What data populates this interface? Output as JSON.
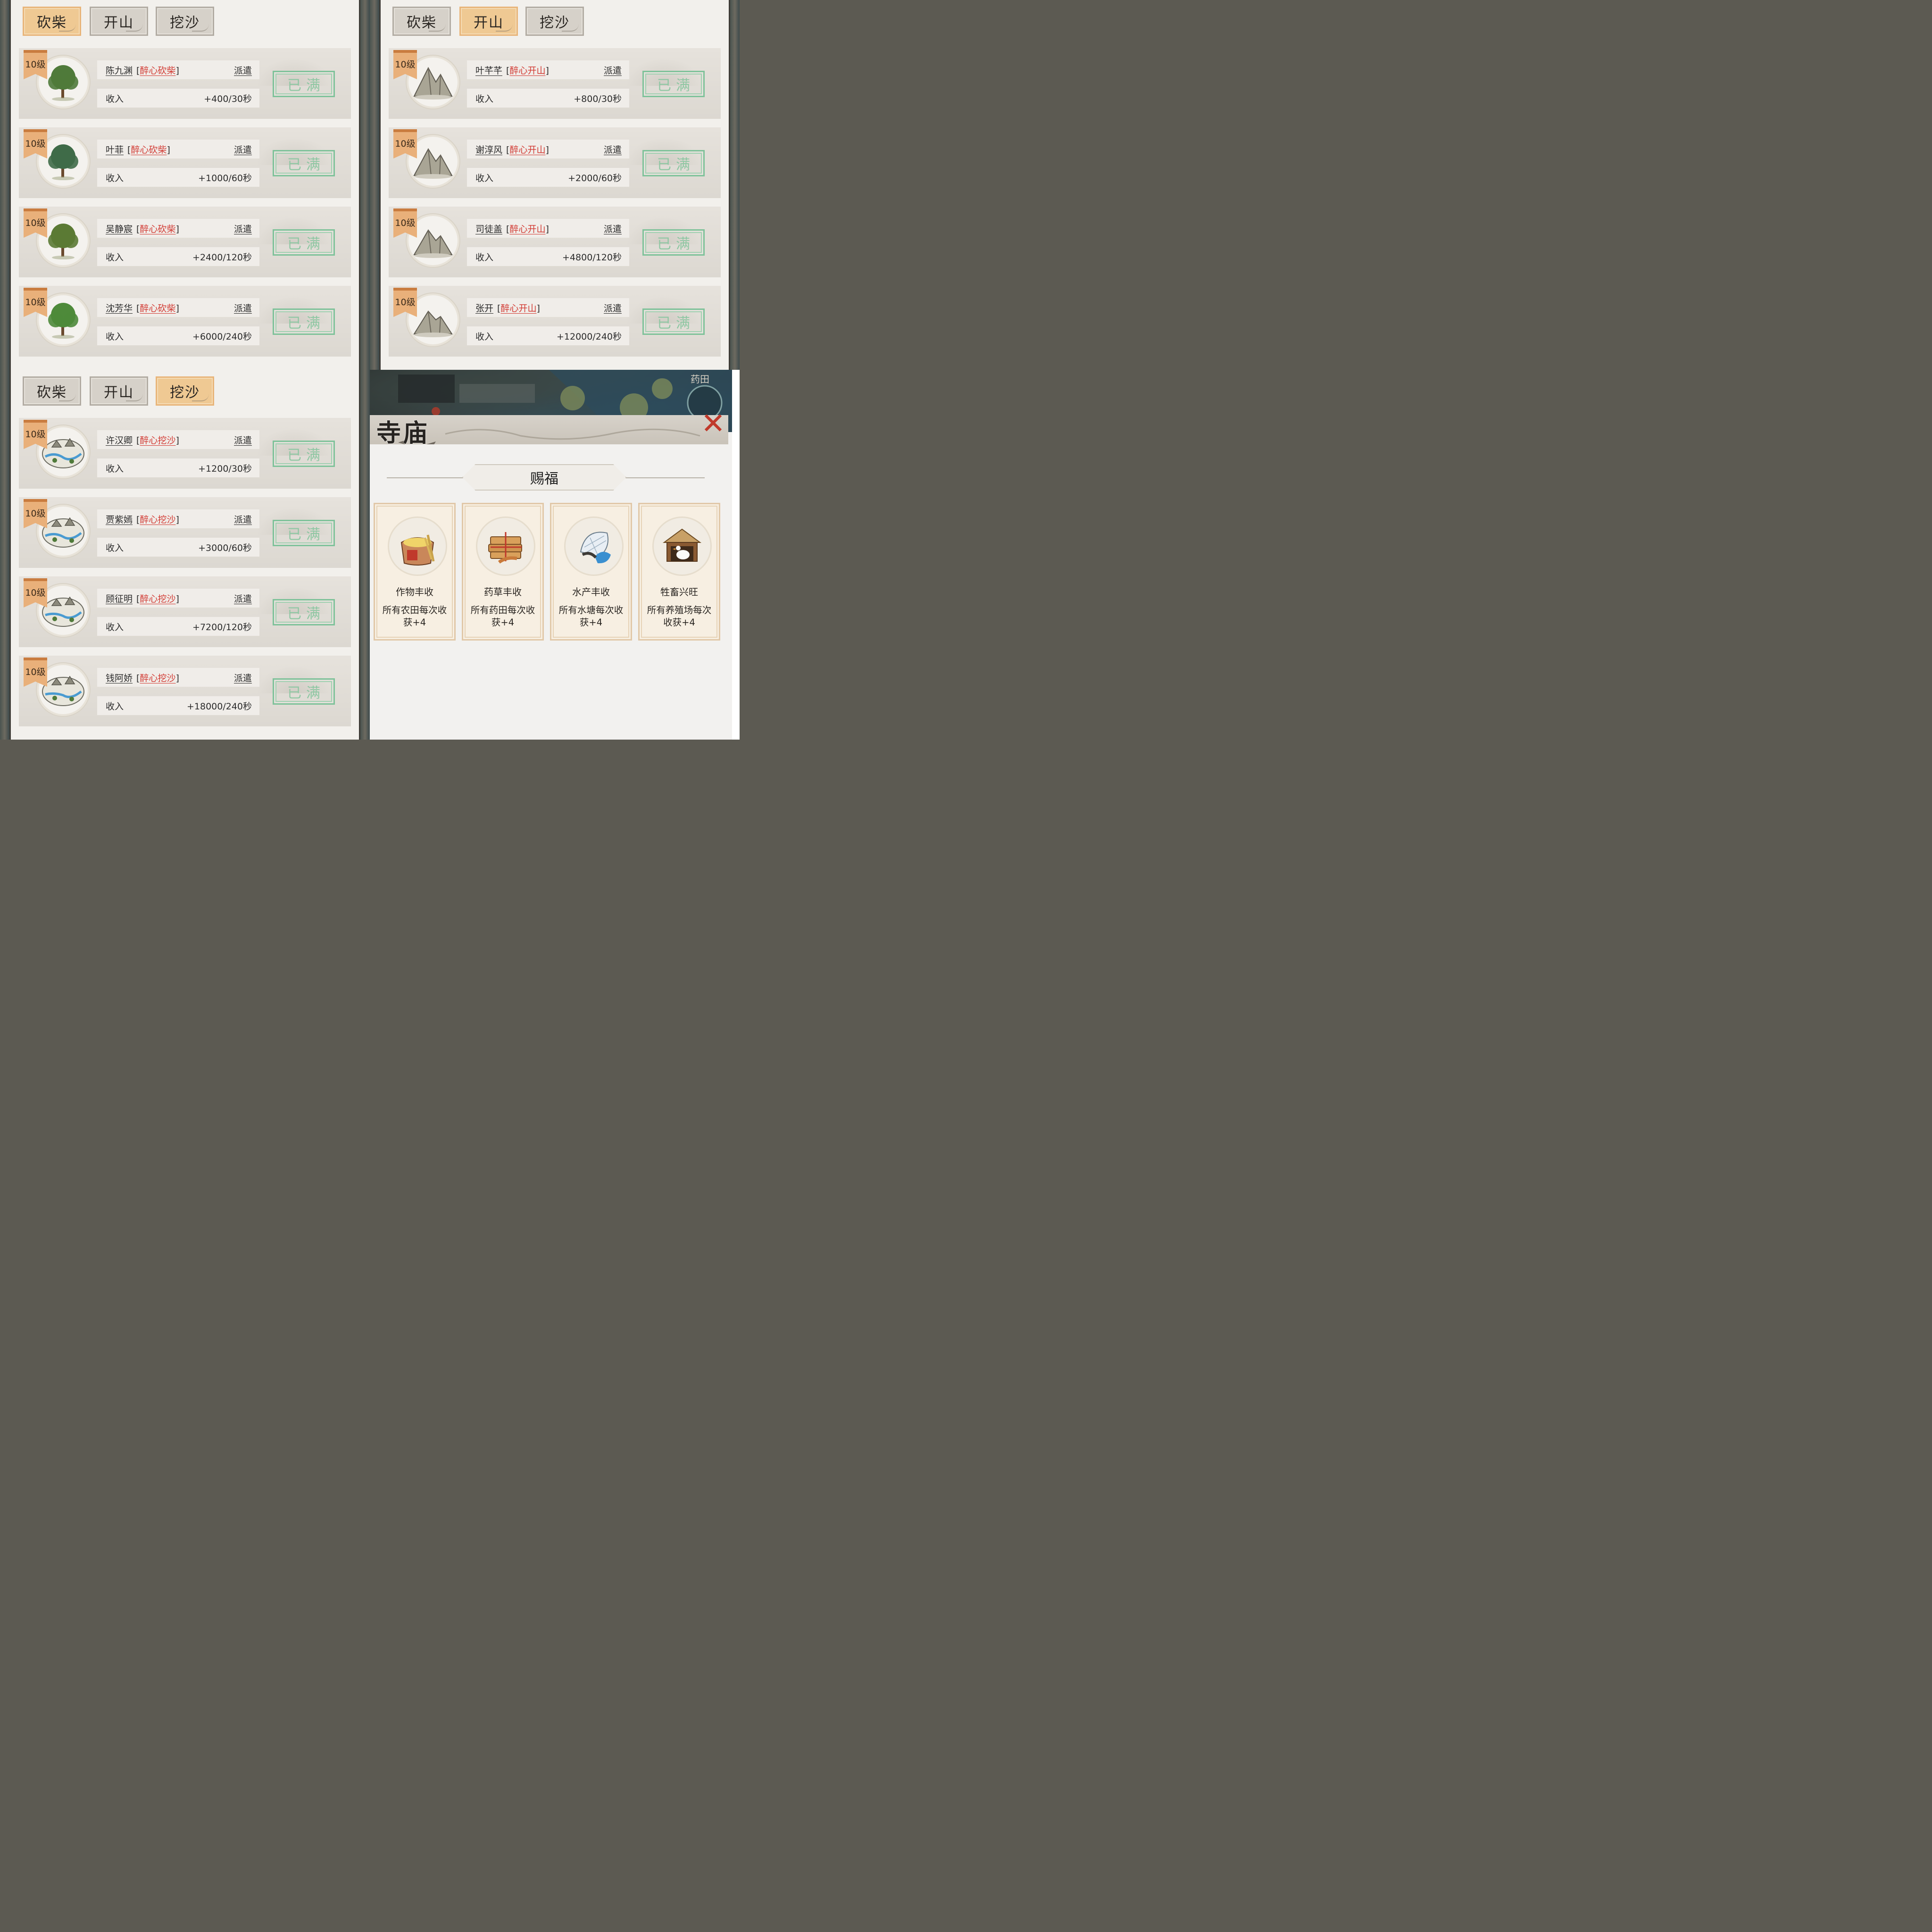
{
  "tabs": [
    "砍柴",
    "开山",
    "挖沙"
  ],
  "level_label": "10级",
  "full_label": "已满",
  "dispatch_label": "派遣",
  "income_label": "收入",
  "panels": [
    {
      "active_tab": 0,
      "rows": [
        {
          "name": "陈九渊",
          "skill": "醉心砍柴",
          "income": "+400/30秒"
        },
        {
          "name": "叶菲",
          "skill": "醉心砍柴",
          "income": "+1000/60秒"
        },
        {
          "name": "吴静宸",
          "skill": "醉心砍柴",
          "income": "+2400/120秒"
        },
        {
          "name": "沈芳华",
          "skill": "醉心砍柴",
          "income": "+6000/240秒"
        }
      ]
    },
    {
      "active_tab": 1,
      "rows": [
        {
          "name": "叶芊芊",
          "skill": "醉心开山",
          "income": "+800/30秒"
        },
        {
          "name": "谢淳风",
          "skill": "醉心开山",
          "income": "+2000/60秒"
        },
        {
          "name": "司徒盖",
          "skill": "醉心开山",
          "income": "+4800/120秒"
        },
        {
          "name": "张开",
          "skill": "醉心开山",
          "income": "+12000/240秒"
        }
      ]
    },
    {
      "active_tab": 2,
      "rows": [
        {
          "name": "许汉卿",
          "skill": "醉心挖沙",
          "income": "+1200/30秒"
        },
        {
          "name": "贾紫嫣",
          "skill": "醉心挖沙",
          "income": "+3000/60秒"
        },
        {
          "name": "顾征明",
          "skill": "醉心挖沙",
          "income": "+7200/120秒"
        },
        {
          "name": "钱阿娇",
          "skill": "醉心挖沙",
          "income": "+18000/240秒"
        }
      ]
    }
  ],
  "temple": {
    "title": "寺庙",
    "scene_label": "药田",
    "section_title": "赐福",
    "cards": [
      {
        "title": "作物丰收",
        "desc": "所有农田每次收获+4",
        "icon": "grain-sack-icon"
      },
      {
        "title": "药草丰收",
        "desc": "所有药田每次收获+4",
        "icon": "herb-bundle-icon"
      },
      {
        "title": "水产丰收",
        "desc": "所有水塘每次收获+4",
        "icon": "fishing-net-icon"
      },
      {
        "title": "牲畜兴旺",
        "desc": "所有养殖场每次收获+4",
        "icon": "goose-shed-icon"
      }
    ]
  },
  "colors": {
    "active_tab": "#efc993",
    "skill_text": "#d23a33",
    "full_button": "#7fc29a",
    "level_badge": "#e9b07a"
  }
}
